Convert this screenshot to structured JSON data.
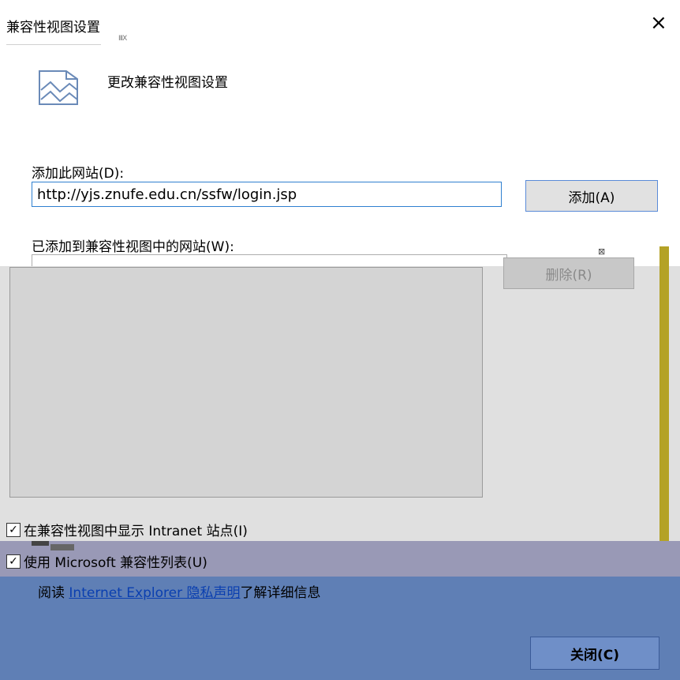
{
  "dialog": {
    "title": "兼容性视图设置",
    "close_glyph": "×",
    "header_text": "更改兼容性视图设置",
    "artifact_small": "ⅡIX"
  },
  "add_site": {
    "label": "添加此网站(D):",
    "value": "http://yjs.znufe.edu.cn/ssfw/login.jsp",
    "add_button": "添加(A)"
  },
  "site_list": {
    "label": "已添加到兼容性视图中的网站(W):",
    "items": [],
    "remove_button": "删除(R)"
  },
  "options": {
    "intranet": {
      "label": "在兼容性视图中显示 Intranet 站点(I)",
      "checked": true
    },
    "ms_list": {
      "label": "使用 Microsoft 兼容性列表(U)",
      "checked": true
    }
  },
  "privacy": {
    "prefix": "阅读",
    "link": "Internet Explorer 隐私声明",
    "suffix": "了解详细信息"
  },
  "footer": {
    "close_button": "关闭(C)"
  },
  "icons": {
    "page_icon": "compat-view-icon",
    "close_icon": "close-icon",
    "check_icon": "checkmark-icon"
  },
  "colors": {
    "input_border": "#2f80d0",
    "link": "#0a3fb0",
    "purple_band": "#9999b6",
    "blue_band": "#5f7fb5",
    "olive_strip": "#b4a226"
  }
}
